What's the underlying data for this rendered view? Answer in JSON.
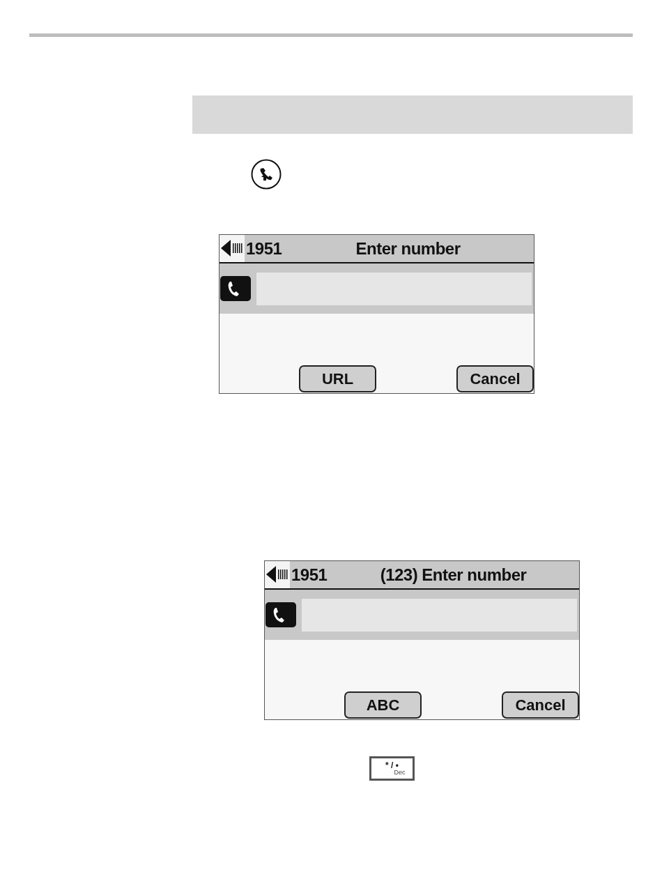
{
  "screens": [
    {
      "line": "1951",
      "title": "Enter number",
      "softkeys": [
        "URL",
        "Cancel"
      ]
    },
    {
      "line": "1951",
      "title": "(123) Enter number",
      "softkeys": [
        "ABC",
        "Cancel"
      ]
    }
  ],
  "key": {
    "main": "* / •",
    "sub": "Dec"
  }
}
